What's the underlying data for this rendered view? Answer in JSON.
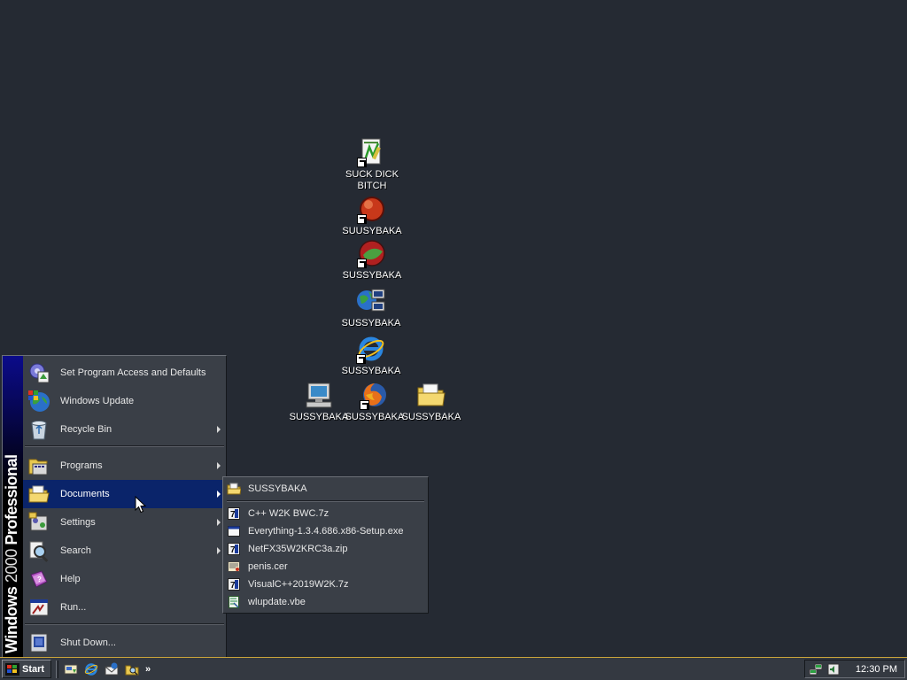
{
  "desktop": {
    "icons": [
      {
        "label": "SUCK DICK\nBITCH",
        "icon": "notepad-shortcut-icon"
      },
      {
        "label": "SUUSYBAKA",
        "icon": "red-ball-shortcut-icon"
      },
      {
        "label": "SUSSYBAKA",
        "icon": "green-red-disc-shortcut-icon"
      },
      {
        "label": "SUSSYBAKA",
        "icon": "network-places-icon"
      },
      {
        "label": "SUSSYBAKA",
        "icon": "internet-explorer-shortcut-icon"
      },
      {
        "label": "SUSSYBAKA",
        "icon": "my-computer-icon"
      },
      {
        "label": "SUSSYBAKA",
        "icon": "firefox-shortcut-icon"
      },
      {
        "label": "SUSSYBAKA",
        "icon": "my-documents-folder-icon"
      }
    ]
  },
  "start_menu": {
    "banner_bold_1": "Windows",
    "banner_light": "2000",
    "banner_bold_2": "Professional",
    "items": [
      {
        "label": "Set Program Access and Defaults",
        "icon": "program-access-icon",
        "submenu": false
      },
      {
        "label": "Windows Update",
        "icon": "windows-update-icon",
        "submenu": false
      },
      {
        "label": "Recycle Bin",
        "icon": "recycle-bin-icon",
        "submenu": true
      },
      {
        "label": "Programs",
        "icon": "programs-folder-icon",
        "submenu": true
      },
      {
        "label": "Documents",
        "icon": "documents-folder-icon",
        "submenu": true,
        "active": true
      },
      {
        "label": "Settings",
        "icon": "settings-icon",
        "submenu": true
      },
      {
        "label": "Search",
        "icon": "search-icon",
        "submenu": true
      },
      {
        "label": "Help",
        "icon": "help-book-icon",
        "submenu": false
      },
      {
        "label": "Run...",
        "icon": "run-icon",
        "submenu": false
      },
      {
        "label": "Shut Down...",
        "icon": "shut-down-icon",
        "submenu": false
      }
    ]
  },
  "documents_menu": {
    "items": [
      {
        "label": "SUSSYBAKA",
        "icon": "folder-icon"
      },
      {
        "label": "C++ W2K BWC.7z",
        "icon": "7z-archive-icon"
      },
      {
        "label": "Everything-1.3.4.686.x86-Setup.exe",
        "icon": "exe-window-icon"
      },
      {
        "label": "NetFX35W2KRC3a.zip",
        "icon": "zip-archive-icon"
      },
      {
        "label": "penis.cer",
        "icon": "certificate-icon"
      },
      {
        "label": "VisualC++2019W2K.7z",
        "icon": "7z-archive-icon"
      },
      {
        "label": "wlupdate.vbe",
        "icon": "script-icon"
      }
    ]
  },
  "taskbar": {
    "start_label": "Start",
    "quick_launch": [
      "show-desktop-icon",
      "internet-explorer-icon",
      "outlook-express-icon",
      "explorer-icon"
    ],
    "quick_launch_more": "»",
    "tray_icons": [
      "network-tray-icon",
      "volume-tray-icon"
    ],
    "clock": "12:30 PM"
  },
  "colors": {
    "desktop": "#252a33",
    "menu_bg": "#3a3f47",
    "highlight": "#0a246a",
    "taskbar": "#343941",
    "taskbar_border": "#c9a33a"
  }
}
